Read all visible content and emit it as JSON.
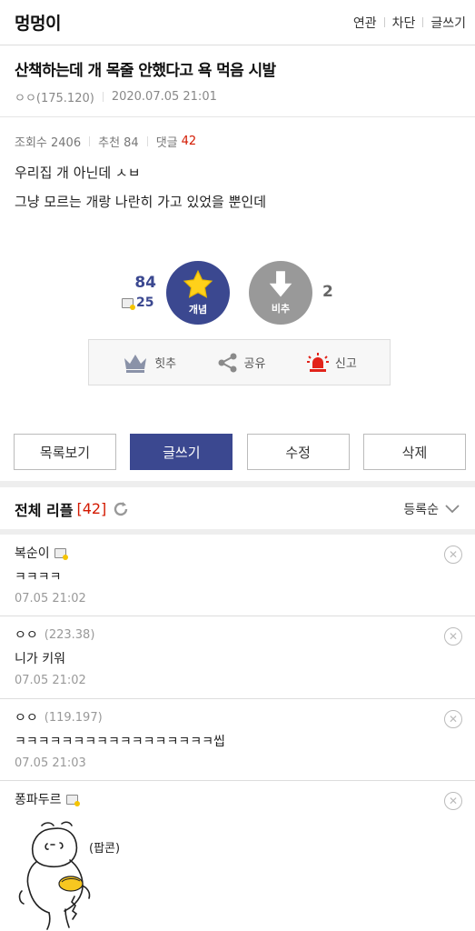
{
  "header": {
    "gallery_name": "멍멍이",
    "links": [
      "연관",
      "차단",
      "글쓰기"
    ]
  },
  "post": {
    "title": "산책하는데 개 목줄 안했다고 욕 먹음 시발",
    "author": "ㅇㅇ(175.120)",
    "datetime": "2020.07.05 21:01",
    "views_label": "조회수 2406",
    "recommend_label": "추천 84",
    "comments_label": "댓글",
    "comments_count": "42",
    "body_lines": [
      "우리집 개 아닌데 ㅅㅂ",
      "그냥 모르는 개랑 나란히 가고 있었을 뿐인데"
    ]
  },
  "vote": {
    "up_count": "84",
    "fixed_count": "25",
    "up_label": "개념",
    "down_label": "비추",
    "down_count": "2"
  },
  "actions": {
    "hit_label": "힛추",
    "share_label": "공유",
    "report_label": "신고"
  },
  "buttons": {
    "list": "목록보기",
    "write": "글쓰기",
    "edit": "수정",
    "delete": "삭제"
  },
  "comments_section": {
    "title": "전체 리플",
    "count": "[42]",
    "sort_label": "등록순"
  },
  "comments": [
    {
      "nick": "복순이",
      "ip": "",
      "text": "ㅋㅋㅋㅋ",
      "date": "07.05 21:02"
    },
    {
      "nick": "ㅇㅇ",
      "ip": "(223.38)",
      "text": "니가 키워",
      "date": "07.05 21:02"
    },
    {
      "nick": "ㅇㅇ",
      "ip": "(119.197)",
      "text": "ㅋㅋㅋㅋㅋㅋㅋㅋㅋㅋㅋㅋㅋㅋㅋㅋㅋ씹",
      "date": "07.05 21:03"
    },
    {
      "nick": "퐁파두르",
      "ip": "",
      "text": "",
      "date": ""
    }
  ],
  "dccon": {
    "caption": "(팝콘)"
  },
  "colors": {
    "accent": "#3b4890",
    "count_red": "#d31900",
    "report_red": "#e2231a"
  }
}
